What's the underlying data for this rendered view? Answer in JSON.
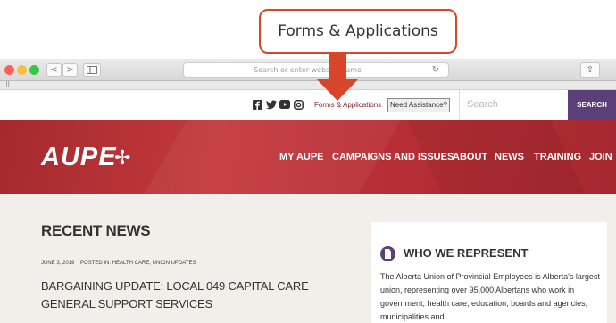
{
  "callout": {
    "label": "Forms & Applications"
  },
  "browser": {
    "address_placeholder": "Search or enter website name",
    "back_glyph": "<",
    "forward_glyph": ">",
    "reload_glyph": "↻",
    "share_glyph": "⇧"
  },
  "utility": {
    "social_icons": [
      "facebook-icon",
      "twitter-icon",
      "youtube-icon",
      "instagram-icon"
    ],
    "forms_link": "Forms & Applications",
    "assist_button": "Need Assistance?",
    "search_placeholder": "Search",
    "search_button": "SEARCH"
  },
  "nav": {
    "logo": "AUPE",
    "items": [
      "MY AUPE",
      "CAMPAIGNS AND ISSUES",
      "ABOUT",
      "NEWS",
      "TRAINING",
      "JOIN"
    ]
  },
  "news": {
    "heading": "RECENT NEWS",
    "date": "JUNE 3, 2019",
    "posted_in": "POSTED IN: HEALTH CARE, UNION UPDATES",
    "title": "BARGAINING UPDATE: LOCAL 049 CAPITAL CARE GENERAL SUPPORT SERVICES"
  },
  "represent": {
    "title": "WHO WE REPRESENT",
    "body": "The Alberta Union of Provincial Employees is Alberta's largest union, representing over 95,000 Albertans who work in government, health care, education, boards and agencies, municipalities and"
  },
  "colors": {
    "accent_red": "#d9452b",
    "brand_purple": "#5b3f78",
    "nav_red": "#b92f36",
    "link_maroon": "#8c2331"
  }
}
